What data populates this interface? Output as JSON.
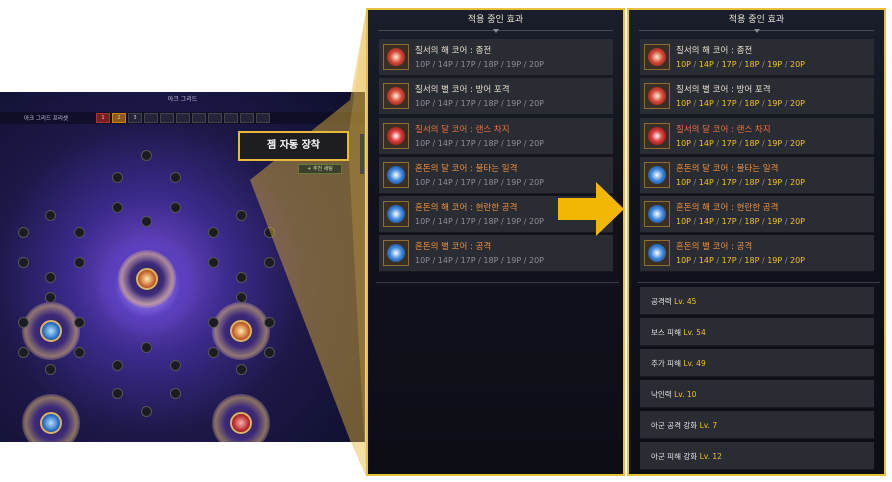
{
  "grid": {
    "title": "아크 그리드",
    "preset_label": "아크 그리드 프리셋",
    "preset_slots": [
      "1",
      "2",
      "3",
      "",
      "",
      "",
      "",
      "",
      "",
      "",
      ""
    ],
    "callout": "젬 자동 장착",
    "recommend_button": "+ 추천 세팅"
  },
  "colors": {
    "accent_gold": "#e9bf3b",
    "point_active": "#f0c419",
    "order_name": "#e6e0cf",
    "chaos_name": "#ee6f42"
  },
  "left_panel": {
    "header": "적용 중인 효과",
    "cores": [
      {
        "name": "질서의 해 코어 : 종전",
        "icon": "order-sun-core-icon",
        "points": [
          "10P",
          "14P",
          "17P",
          "18P",
          "19P",
          "20P"
        ],
        "active": 0
      },
      {
        "name": "질서의 별 코어 : 방어 포격",
        "icon": "order-star-core-icon",
        "points": [
          "10P",
          "14P",
          "17P",
          "18P",
          "19P",
          "20P"
        ],
        "active": 0
      },
      {
        "name": "질서의 달 코어 : 랜스 차지",
        "icon": "order-moon-core-icon",
        "points": [
          "10P",
          "14P",
          "17P",
          "18P",
          "19P",
          "20P"
        ],
        "active": 0
      },
      {
        "name": "혼돈의 달 코어 : 불타는 일격",
        "icon": "chaos-moon-core-icon",
        "points": [
          "10P",
          "14P",
          "17P",
          "18P",
          "19P",
          "20P"
        ],
        "active": 0
      },
      {
        "name": "혼돈의 해 코어 : 현란한 공격",
        "icon": "chaos-sun-core-icon",
        "points": [
          "10P",
          "14P",
          "17P",
          "18P",
          "19P",
          "20P"
        ],
        "active": 0
      },
      {
        "name": "혼돈의 별 코어 : 공격",
        "icon": "chaos-star-core-icon",
        "points": [
          "10P",
          "14P",
          "17P",
          "18P",
          "19P",
          "20P"
        ],
        "active": 0
      }
    ]
  },
  "right_panel": {
    "header": "적용 중인 효과",
    "cores": [
      {
        "name": "질서의 해 코어 : 종전",
        "icon": "order-sun-core-icon",
        "points": [
          "10P",
          "14P",
          "17P",
          "18P",
          "19P",
          "20P"
        ],
        "active": 6
      },
      {
        "name": "질서의 별 코어 : 방어 포격",
        "icon": "order-star-core-icon",
        "points": [
          "10P",
          "14P",
          "17P",
          "18P",
          "19P",
          "20P"
        ],
        "active": 6
      },
      {
        "name": "질서의 달 코어 : 랜스 차지",
        "icon": "order-moon-core-icon",
        "points": [
          "10P",
          "14P",
          "17P",
          "18P",
          "19P",
          "20P"
        ],
        "active": 6
      },
      {
        "name": "혼돈의 달 코어 : 불타는 일격",
        "icon": "chaos-moon-core-icon",
        "points": [
          "10P",
          "14P",
          "17P",
          "18P",
          "19P",
          "20P"
        ],
        "active": 6
      },
      {
        "name": "혼돈의 해 코어 : 현란한 공격",
        "icon": "chaos-sun-core-icon",
        "points": [
          "10P",
          "14P",
          "17P",
          "18P",
          "19P",
          "20P"
        ],
        "active": 6
      },
      {
        "name": "혼돈의 별 코어 : 공격",
        "icon": "chaos-star-core-icon",
        "points": [
          "10P",
          "14P",
          "17P",
          "18P",
          "19P",
          "20P"
        ],
        "active": 6
      }
    ],
    "effects": [
      {
        "name": "공격력",
        "level": "Lv. 45"
      },
      {
        "name": "보스 피해",
        "level": "Lv. 54"
      },
      {
        "name": "추가 피해",
        "level": "Lv. 49"
      },
      {
        "name": "낙인력",
        "level": "Lv. 10"
      },
      {
        "name": "아군 공격 강화",
        "level": "Lv. 7"
      },
      {
        "name": "아군 피해 강화",
        "level": "Lv. 12"
      }
    ]
  }
}
